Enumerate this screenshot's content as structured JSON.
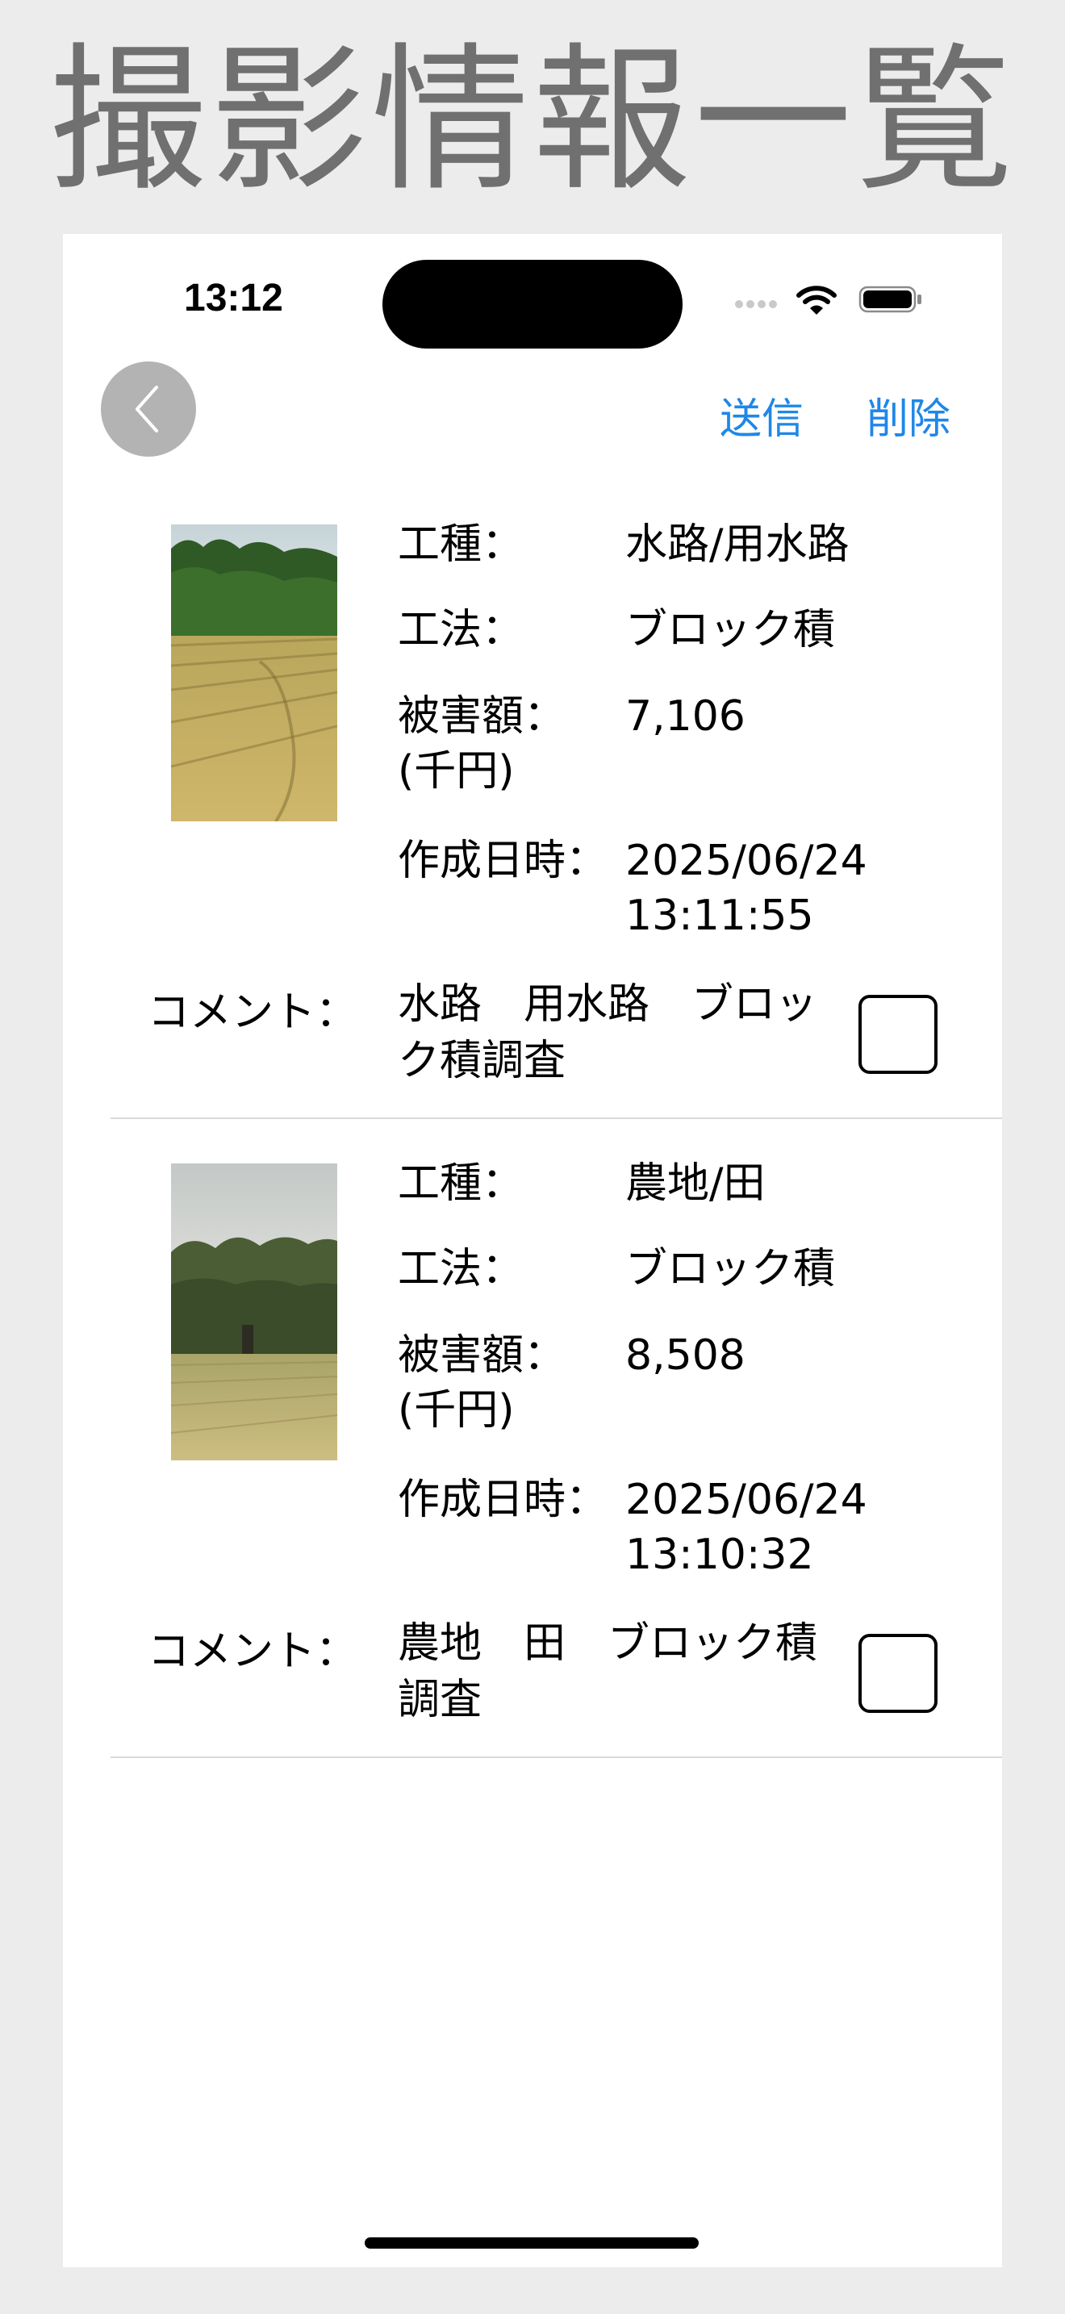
{
  "page_title": "撮影情報一覧",
  "status_bar": {
    "time": "13:12"
  },
  "nav": {
    "send_label": "送信",
    "delete_label": "削除",
    "accent_color": "#1f87e8"
  },
  "labels": {
    "work_type": "工種：",
    "method": "工法：",
    "damage_line1": "被害額：",
    "damage_line2": "(千円)",
    "created_at": "作成日時：",
    "comment": "コメント："
  },
  "records": [
    {
      "work_type": "水路/用水路",
      "method": "ブロック積",
      "damage": "7,106",
      "created_date": "2025/06/24",
      "created_time": "13:11:55",
      "comment": "水路　用水路　ブロック積調査",
      "checked": false
    },
    {
      "work_type": "農地/田",
      "method": "ブロック積",
      "damage": "8,508",
      "created_date": "2025/06/24",
      "created_time": "13:10:32",
      "comment": "農地　田　ブロック積調査",
      "checked": false
    }
  ]
}
